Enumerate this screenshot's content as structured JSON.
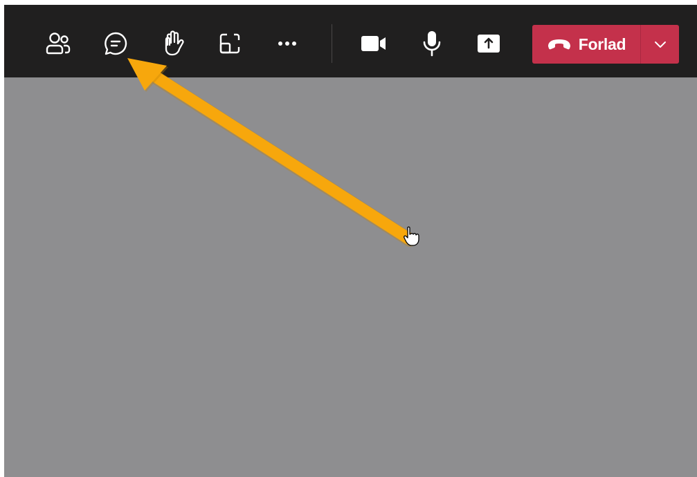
{
  "toolbar": {
    "background_color": "#201f1f",
    "icon_color": "#ffffff",
    "buttons": [
      {
        "name": "participants",
        "icon": "people-icon"
      },
      {
        "name": "chat",
        "icon": "chat-icon"
      },
      {
        "name": "raise-hand",
        "icon": "hand-icon"
      },
      {
        "name": "rooms",
        "icon": "breakout-rooms-icon"
      },
      {
        "name": "more",
        "icon": "more-icon"
      },
      {
        "name": "camera",
        "icon": "camera-icon"
      },
      {
        "name": "microphone",
        "icon": "mic-icon"
      },
      {
        "name": "share",
        "icon": "share-icon"
      }
    ],
    "leave": {
      "label": "Forlad",
      "icon": "phone-hangup-icon",
      "dropdown_icon": "chevron-down-icon",
      "color": "#c4314b"
    }
  },
  "stage": {
    "background_color": "#8e8e90"
  },
  "annotation": {
    "arrow_color": "#f7a70c",
    "points_to": "chat-button",
    "cursor_icon": "hand-cursor-icon"
  }
}
